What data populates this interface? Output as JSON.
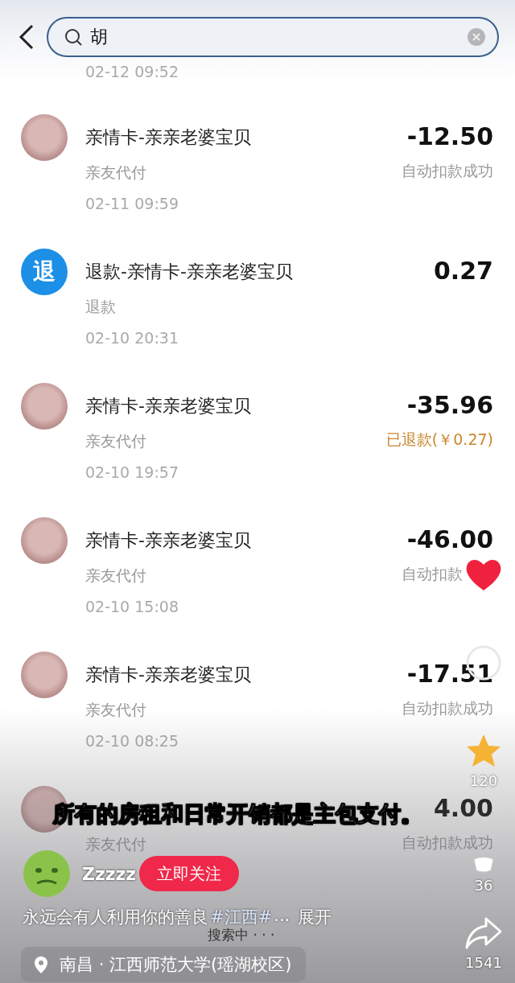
{
  "search": {
    "value": "胡"
  },
  "top_date": "02-12 09:52",
  "transactions": [
    {
      "kind": "pet",
      "title": "亲情卡-亲亲老婆宝贝",
      "amount": "-12.50",
      "method": "亲友代付",
      "status": "自动扣款成功",
      "refunded": false,
      "time": "02-11 09:59"
    },
    {
      "kind": "refund",
      "icon": "退",
      "title": "退款-亲情卡-亲亲老婆宝贝",
      "amount": "0.27",
      "method": "退款",
      "time": "02-10 20:31"
    },
    {
      "kind": "pet",
      "title": "亲情卡-亲亲老婆宝贝",
      "amount": "-35.96",
      "method": "亲友代付",
      "status": "已退款(￥0.27)",
      "refunded": true,
      "time": "02-10 19:57"
    },
    {
      "kind": "pet",
      "title": "亲情卡-亲亲老婆宝贝",
      "amount": "-46.00",
      "method": "亲友代付",
      "status": "自动扣款",
      "refunded": false,
      "time": "02-10 15:08"
    },
    {
      "kind": "pet",
      "title": "亲情卡-亲亲老婆宝贝",
      "amount": "-17.51",
      "method": "亲友代付",
      "status": "自动扣款成功",
      "refunded": false,
      "time": "02-10 08:25"
    },
    {
      "kind": "pet",
      "amount": "4.00",
      "method": "亲友代付",
      "status": "自动扣款成功",
      "refunded": false
    }
  ],
  "video": {
    "subtitle": "所有的房租和日常开销都是主包支付。",
    "actions": [
      {
        "kind": "like",
        "liked": true
      },
      {
        "kind": "comment"
      },
      {
        "kind": "favorite",
        "favorited": true,
        "count": "120"
      },
      {
        "kind": "reaction",
        "count": "36"
      },
      {
        "kind": "share",
        "count": "1541"
      }
    ],
    "author": {
      "name": "Zzzzz",
      "follow": "立即关注"
    },
    "caption": {
      "text": "永远会有人利用你的善良",
      "tag": "#江西#",
      "ellipsis": "...",
      "expand": "展开"
    },
    "search_hint": "搜索中 · · ·",
    "location": "南昌 · 江西师范大学(瑶湖校区)"
  }
}
